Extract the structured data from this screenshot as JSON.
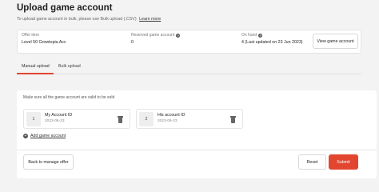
{
  "header": {
    "title": "Upload game account",
    "subtitle": "To upload game account in bulk, please use Bulk upload (.CSV)",
    "learn_more": "Learn more"
  },
  "offer_info": {
    "offer_item_label": "Offer item",
    "offer_item_value": "Level 50 Growtopia Acc",
    "reserved_label": "Reserved game account",
    "reserved_value": "0",
    "on_hand_label": "On hand",
    "on_hand_value": "4 (Last updated on 23 Jun 2023)",
    "view_button": "View game account"
  },
  "tabs": [
    {
      "label": "Manual upload",
      "active": true
    },
    {
      "label": "Bulk upload",
      "active": false
    }
  ],
  "manual": {
    "note": "Make sure all the game account are valid to be sold",
    "accounts": [
      {
        "index": "1",
        "id": "My Account ID",
        "date": "2023-06-23"
      },
      {
        "index": "2",
        "id": "His account ID",
        "date": "2023-06-23"
      }
    ],
    "add_label": "Add game account"
  },
  "footer": {
    "back_label": "Back to manage offer",
    "reset_label": "Reset",
    "submit_label": "Submit"
  },
  "colors": {
    "accent": "#e2462f",
    "background": "#f3f3f4"
  },
  "icons": [
    "help-icon",
    "trash-icon",
    "plus-circle-icon"
  ]
}
